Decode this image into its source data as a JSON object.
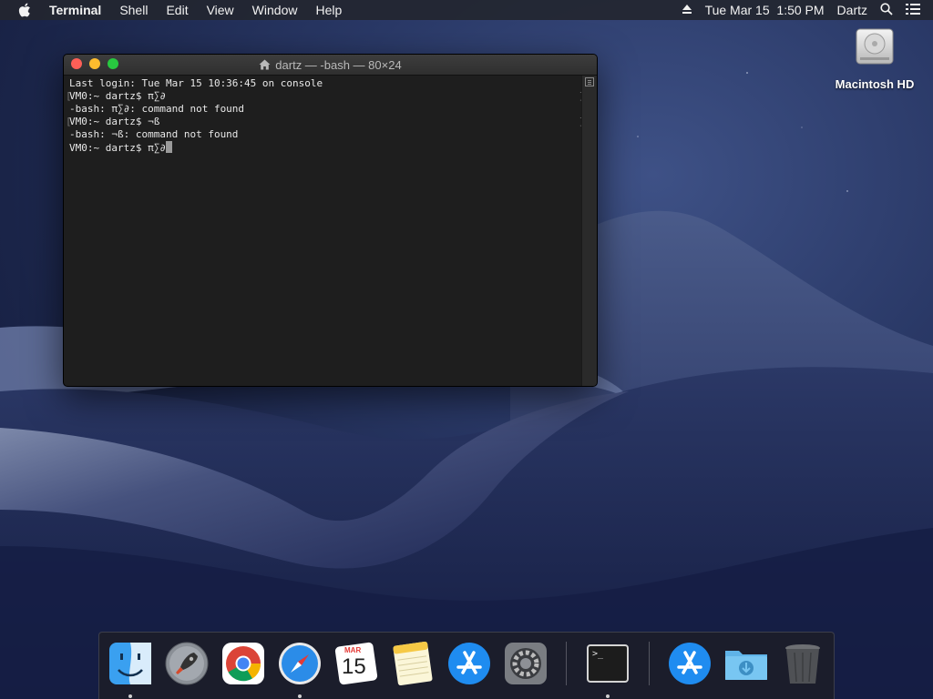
{
  "menubar": {
    "app_name": "Terminal",
    "menus": [
      "Shell",
      "Edit",
      "View",
      "Window",
      "Help"
    ],
    "clock": "Tue Mar 15  1:50 PM",
    "user": "Dartz"
  },
  "desktop": {
    "icons": [
      {
        "label": "Macintosh HD"
      }
    ]
  },
  "terminal": {
    "title": "dartz — -bash — 80×24",
    "lines": [
      "Last login: Tue Mar 15 10:36:45 on console",
      "VM0:~ dartz$ π∑∂",
      "-bash: π∑∂: command not found",
      "VM0:~ dartz$ ¬ß",
      "-bash: ¬ß: command not found",
      "VM0:~ dartz$ π∑∂"
    ]
  },
  "dock": {
    "apps": [
      {
        "name": "Finder",
        "running": true
      },
      {
        "name": "Launchpad",
        "running": false
      },
      {
        "name": "Google Chrome",
        "running": false
      },
      {
        "name": "Safari",
        "running": true
      },
      {
        "name": "Calendar",
        "month": "MAR",
        "day": "15",
        "running": false
      },
      {
        "name": "Notes",
        "running": false
      },
      {
        "name": "App Store",
        "running": false
      },
      {
        "name": "System Preferences",
        "running": false
      },
      {
        "name": "Terminal",
        "prompt": ">_",
        "running": true
      },
      {
        "name": "App Store Downloads",
        "running": false
      },
      {
        "name": "Downloads",
        "running": false
      },
      {
        "name": "Trash",
        "running": false
      }
    ]
  },
  "colors": {
    "close": "#fe5f57",
    "minimize": "#febc2e",
    "zoom": "#28c840",
    "terminal_bg": "#1e1e1e",
    "menubar_bg": "#232630"
  }
}
